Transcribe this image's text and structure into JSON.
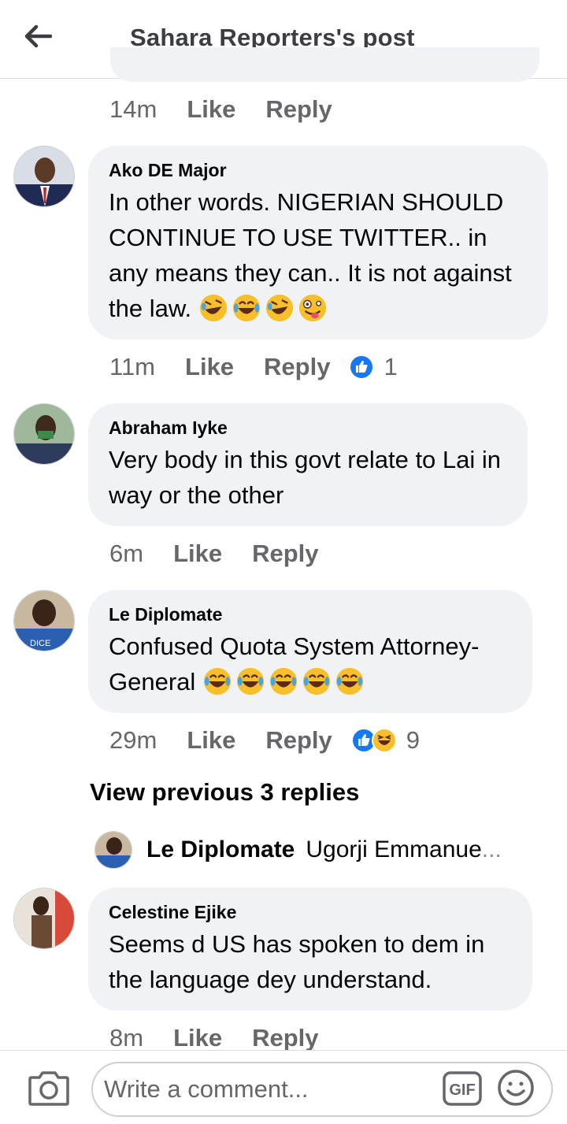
{
  "header": {
    "title": "Sahara Reporters's post",
    "back_icon": "arrow-left-icon"
  },
  "top_meta": {
    "time": "14m",
    "like": "Like",
    "reply": "Reply"
  },
  "comments": [
    {
      "name": "Ako DE Major",
      "text": "In other words.  NIGERIAN SHOULD CONTINUE TO USE TWITTER.. in any means they can..  It is not against the law.",
      "emojis": [
        "rofl-emoji",
        "joy-emoji",
        "rofl-emoji",
        "zany-face-emoji"
      ],
      "time": "11m",
      "like": "Like",
      "reply": "Reply",
      "reactions": [
        "like-reaction"
      ],
      "reaction_count": "1"
    },
    {
      "name": "Abraham Iyke",
      "text": "Very body in this govt relate to Lai in way or the other",
      "time": "6m",
      "like": "Like",
      "reply": "Reply"
    },
    {
      "name": "Le Diplomate",
      "text": "Confused Quota System Attorney-General",
      "emojis": [
        "joy-emoji",
        "joy-emoji",
        "joy-emoji",
        "joy-emoji",
        "joy-emoji"
      ],
      "time": "29m",
      "like": "Like",
      "reply": "Reply",
      "reactions": [
        "like-reaction",
        "haha-reaction"
      ],
      "reaction_count": "9"
    },
    {
      "name": "Celestine Ejike",
      "text": "Seems d US has spoken to dem in the language dey understand.",
      "time": "8m",
      "like": "Like",
      "reply": "Reply"
    }
  ],
  "view_previous": "View previous 3 replies",
  "reply_preview": {
    "name": "Le Diplomate",
    "text": "Ugorji Emmanue",
    "ellipsis": "..."
  },
  "composer": {
    "placeholder": "Write a comment...",
    "gif_label": "GIF"
  },
  "colors": {
    "bubble": "#f0f2f5",
    "meta": "#65676b",
    "like_blue": "#1877f2"
  }
}
